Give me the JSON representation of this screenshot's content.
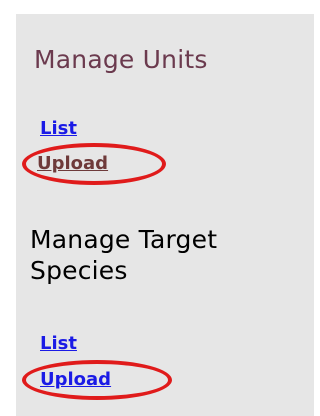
{
  "sections": [
    {
      "heading": "Manage Units",
      "links": [
        "List",
        "Upload"
      ]
    },
    {
      "heading_line1": "Manage Target",
      "heading_line2": "Species",
      "links": [
        "List",
        "Upload"
      ]
    }
  ],
  "colors": {
    "panel_bg": "#e6e6e6",
    "heading_units": "#6b3a4e",
    "heading_species": "#000000",
    "link": "#1a1ae6",
    "visited_link": "#6e3a3a",
    "highlight_circle": "#e01b1b"
  }
}
